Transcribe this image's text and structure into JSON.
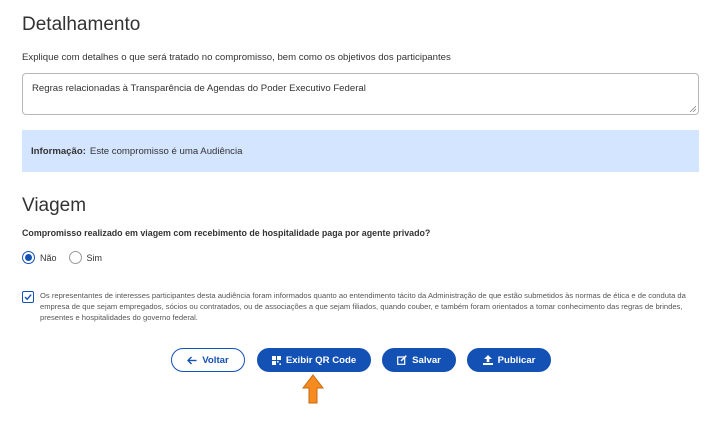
{
  "detalhamento": {
    "title": "Detalhamento",
    "instruction": "Explique com detalhes o que será tratado no compromisso, bem como os objetivos dos participantes",
    "textarea_value": "Regras relacionadas à Transparência de Agendas do Poder Executivo Federal"
  },
  "info": {
    "label": "Informação:",
    "text": "Este compromisso é uma Audiência"
  },
  "viagem": {
    "title": "Viagem",
    "question": "Compromisso realizado em viagem com recebimento de hospitalidade paga por agente privado?",
    "options": [
      {
        "label": "Não",
        "selected": true
      },
      {
        "label": "Sim",
        "selected": false
      }
    ]
  },
  "declaration": {
    "checked": true,
    "text": "Os representantes de interesses participantes desta audiência foram informados quanto ao entendimento tácito da Administração de que estão submetidos às normas de ética e de conduta da empresa de que sejam empregados, sócios ou contratados, ou de associações a que sejam filiados, quando couber, e também foram orientados a tomar conhecimento das regras de brindes, presentes e hospitalidades do governo federal."
  },
  "actions": {
    "back": "Voltar",
    "qr": "Exibir QR Code",
    "save": "Salvar",
    "publish": "Publicar"
  },
  "colors": {
    "primary": "#1351b4",
    "info_bg": "#d4e5ff",
    "pointer_arrow": "#f68b1f"
  },
  "icons": {
    "back": "arrow-left-icon",
    "qr": "qr-code-icon",
    "save": "edit-icon",
    "publish": "upload-icon",
    "pointer": "orange-arrow-up-icon"
  }
}
